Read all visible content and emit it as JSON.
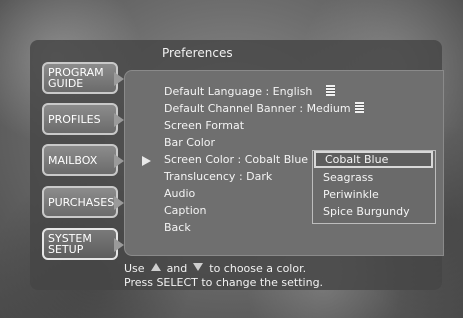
{
  "title": "Preferences",
  "sidebar": {
    "items": [
      {
        "line1": "PROGRAM",
        "line2": "GUIDE"
      },
      {
        "line1": "PROFILES",
        "line2": ""
      },
      {
        "line1": "MAILBOX",
        "line2": ""
      },
      {
        "line1": "PURCHASES",
        "line2": ""
      },
      {
        "line1": "SYSTEM",
        "line2": "SETUP"
      }
    ]
  },
  "menu": {
    "items": [
      "Default Language : English",
      "Default Channel Banner : Medium",
      "Screen Format",
      "Bar Color",
      "Screen Color : Cobalt Blue",
      "Translucency : Dark",
      "Audio",
      "Caption",
      "Back"
    ]
  },
  "dropdown": {
    "options": [
      "Cobalt Blue",
      "Seagrass",
      "Periwinkle",
      "Spice Burgundy"
    ]
  },
  "help": {
    "use": "Use",
    "and": "and",
    "to_choose": "to choose a color.",
    "line2": "Press SELECT to change the setting."
  }
}
